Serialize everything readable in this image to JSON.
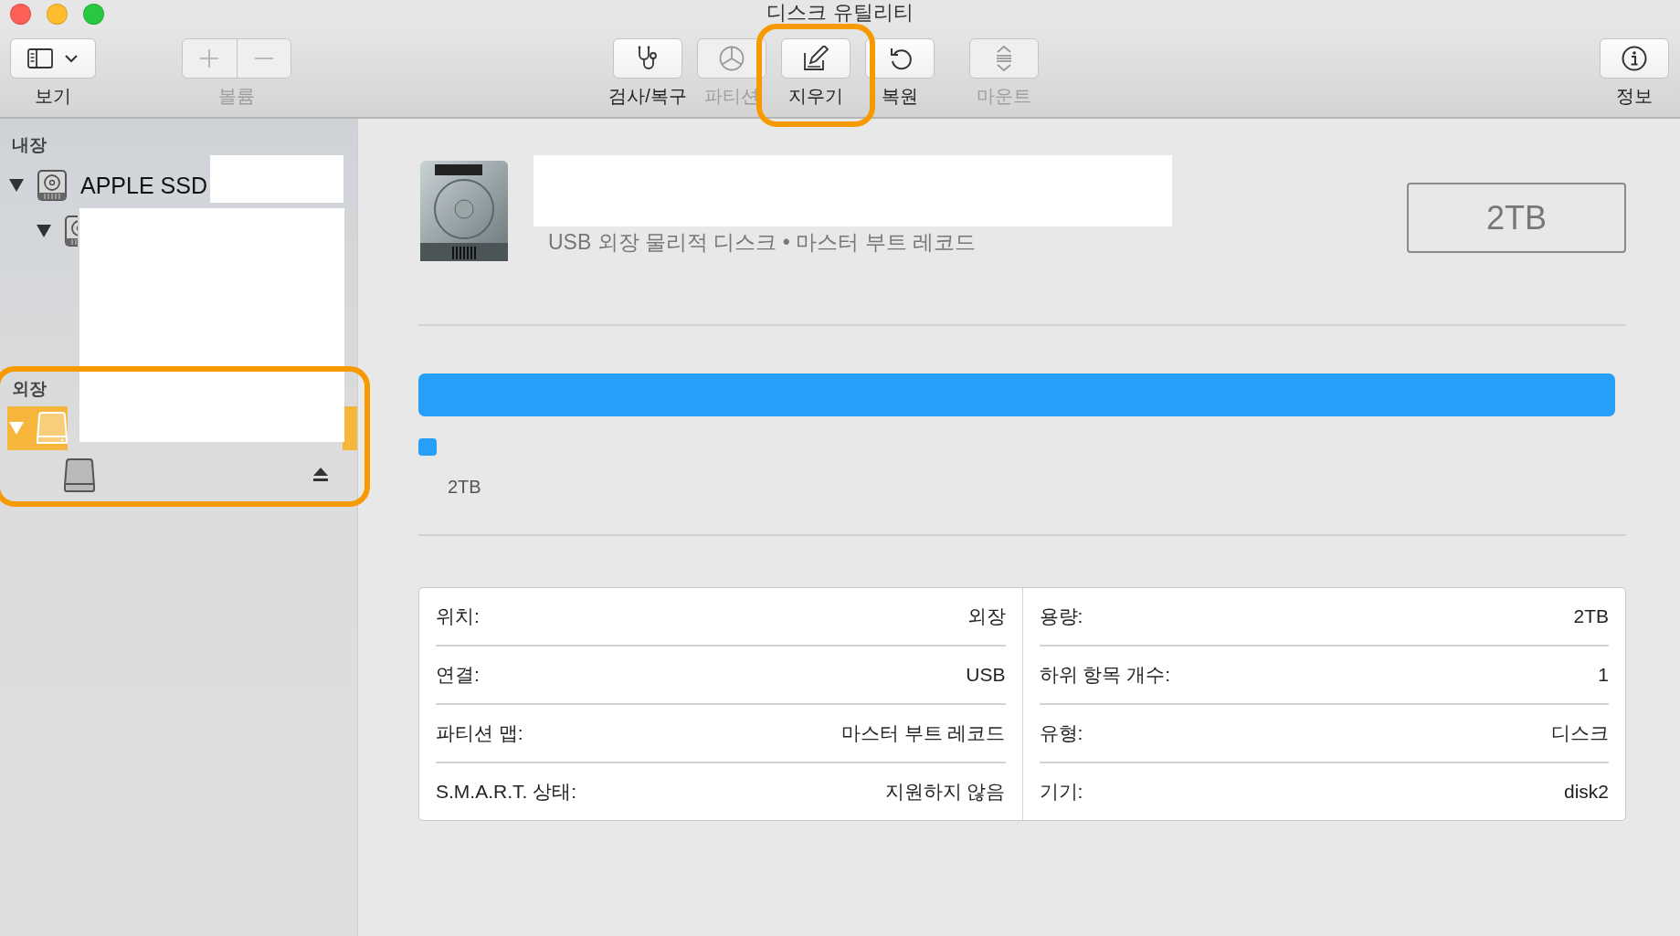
{
  "window": {
    "title": "디스크 유틸리티"
  },
  "toolbar": [
    {
      "kind": "view",
      "label": "보기",
      "disabled": false
    },
    {
      "kind": "volume",
      "label": "볼륨",
      "disabled": true
    },
    {
      "kind": "firstaid",
      "label": "검사/복구",
      "disabled": false
    },
    {
      "kind": "partition",
      "label": "파티션",
      "disabled": true
    },
    {
      "kind": "erase",
      "label": "지우기",
      "disabled": false,
      "highlighted": true
    },
    {
      "kind": "restore",
      "label": "복원",
      "disabled": false
    },
    {
      "kind": "mount",
      "label": "마운트",
      "disabled": true
    },
    {
      "kind": "info",
      "label": "정보",
      "disabled": false
    }
  ],
  "sidebar": {
    "sections": [
      {
        "header": "내장",
        "items": [
          {
            "kind": "internal",
            "label": "APPLE SSD",
            "expanded": true,
            "selected": false,
            "children": [
              {
                "kind": "internal",
                "expanded": true,
                "selected": false
              }
            ]
          }
        ]
      },
      {
        "header": "외장",
        "highlighted": true,
        "items": [
          {
            "kind": "external",
            "expanded": true,
            "selected": true,
            "children": [
              {
                "kind": "volume",
                "selected": false,
                "ejectable": true
              }
            ]
          }
        ]
      }
    ]
  },
  "redactions": [
    {
      "kind": "sidebar_top"
    },
    {
      "kind": "sidebar_body"
    },
    {
      "kind": "disk_name"
    }
  ],
  "detail": {
    "subtitle": "USB 외장 물리적 디스크 • 마스터 부트 레코드",
    "capacity": "2TB",
    "usage": [
      {
        "color": "#279ff8"
      }
    ],
    "legend": [
      {
        "color": "#279ff8",
        "size": "2TB"
      }
    ],
    "info": {
      "left": [
        {
          "label": "위치:",
          "value": "외장"
        },
        {
          "label": "연결:",
          "value": "USB"
        },
        {
          "label": "파티션 맵:",
          "value": "마스터 부트 레코드"
        },
        {
          "label": "S.M.A.R.T. 상태:",
          "value": "지원하지 않음"
        }
      ],
      "right": [
        {
          "label": "용량:",
          "value": "2TB"
        },
        {
          "label": "하위 항목 개수:",
          "value": "1"
        },
        {
          "label": "유형:",
          "value": "디스크"
        },
        {
          "label": "기기:",
          "value": "disk2"
        }
      ]
    }
  }
}
